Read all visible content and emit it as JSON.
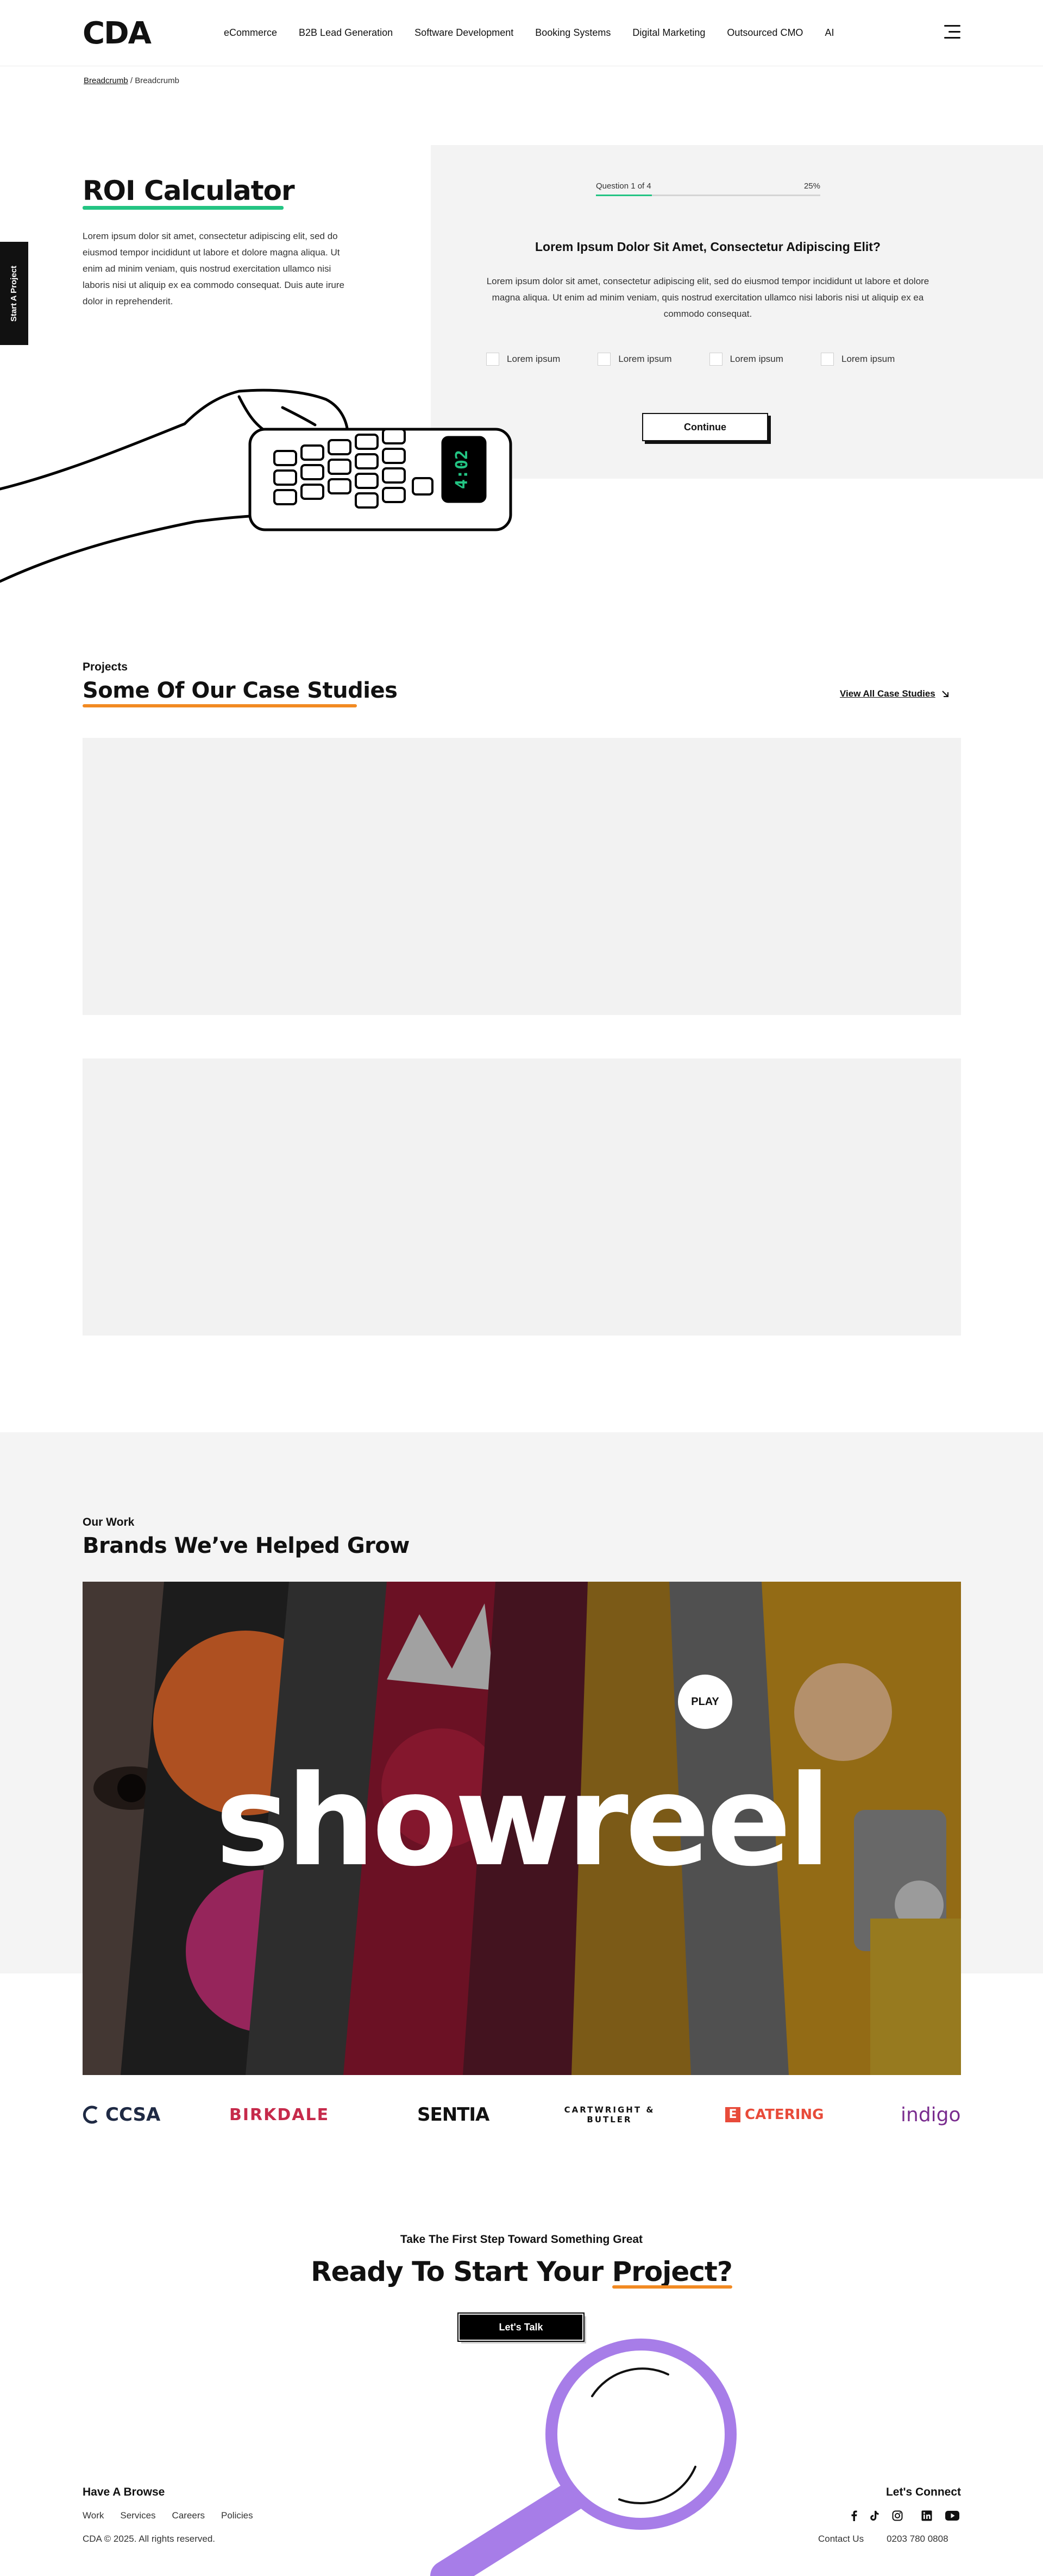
{
  "brand": {
    "logo": "CDA"
  },
  "nav": {
    "items": [
      "eCommerce",
      "B2B Lead Generation",
      "Software Development",
      "Booking Systems",
      "Digital Marketing",
      "Outsourced CMO",
      "AI"
    ]
  },
  "breadcrumb": {
    "link": "Breadcrumb",
    "separator": " / ",
    "current": "Breadcrumb"
  },
  "side_tab": {
    "label": "Start A Project"
  },
  "roi": {
    "title": "ROI Calculator",
    "description": "Lorem ipsum dolor sit amet, consectetur adipiscing elit, sed do eiusmod tempor incididunt ut labore et dolore magna aliqua. Ut enim ad minim veniam, quis nostrud exercitation ullamco nisi laboris nisi ut aliquip ex ea commodo consequat. Duis aute irure dolor in reprehenderit.",
    "calculator_display": "4:02"
  },
  "quiz": {
    "progress_label": "Question 1 of 4",
    "progress_percent": "25%",
    "progress_value": 0.25,
    "question": "Lorem Ipsum Dolor Sit Amet, Consectetur Adipiscing Elit?",
    "body": "Lorem ipsum dolor sit amet, consectetur adipiscing elit, sed do eiusmod tempor incididunt ut labore et dolore magna aliqua. Ut enim ad minim veniam, quis nostrud exercitation ullamco nisi laboris nisi ut aliquip ex ea commodo consequat.",
    "options": [
      "Lorem ipsum",
      "Lorem ipsum",
      "Lorem ipsum",
      "Lorem ipsum"
    ],
    "continue_label": "Continue"
  },
  "projects": {
    "eyebrow": "Projects",
    "title": "Some Of Our Case Studies",
    "view_all": "View All Case Studies"
  },
  "work": {
    "eyebrow": "Our Work",
    "title": "Brands We’ve Helped Grow",
    "showreel_word": "showreel",
    "play_label": "PLAY"
  },
  "brands": [
    "CCSA",
    "BIRKDALE",
    "SENTIA",
    "CARTWRIGHT & BUTLER",
    "CATERING",
    "indigo"
  ],
  "cta": {
    "subtitle": "Take The First Step Toward Something Great",
    "title_lead": "Ready To Start Your ",
    "title_highlight": "Project?",
    "button": "Let's Talk"
  },
  "footer": {
    "browse_heading": "Have A Browse",
    "links": [
      "Work",
      "Services",
      "Careers",
      "Policies"
    ],
    "copyright": "CDA © 2025. All rights reserved.",
    "connect_heading": "Let's Connect",
    "contact_label": "Contact Us",
    "phone": "0203 780 0808",
    "social_icons": [
      "facebook-icon",
      "tiktok-icon",
      "instagram-icon",
      "linkedin-icon",
      "youtube-icon"
    ]
  },
  "colors": {
    "accent_green": "#23c483",
    "accent_orange": "#f28a22",
    "magnifier_purple": "#a77de8"
  }
}
